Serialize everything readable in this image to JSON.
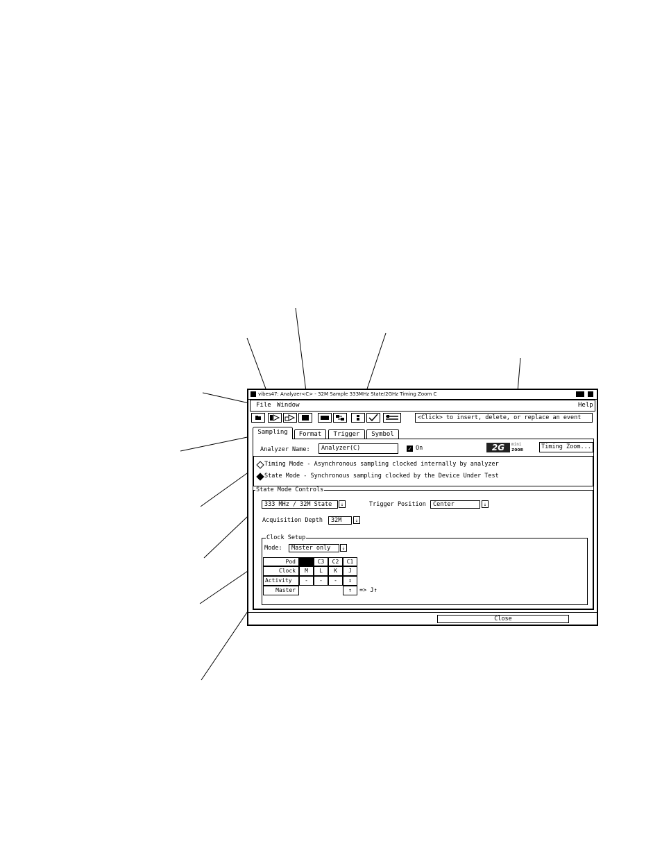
{
  "window": {
    "title": "vibes47: Analyzer<C> - 32M Sample 333MHz State/2GHz Timing Zoom C"
  },
  "menu": {
    "file": "File",
    "window": "Window",
    "help": "Help"
  },
  "toolbar": {
    "hint": "<Click> to insert, delete, or replace an event",
    "icons": [
      "open-folder-icon",
      "run-icon",
      "run-repetitive-icon",
      "stop-icon",
      "display-icon",
      "connect-icon",
      "properties-icon",
      "checkmark-icon",
      "probe-icon"
    ]
  },
  "tabs": {
    "sampling": "Sampling",
    "format": "Format",
    "trigger": "Trigger",
    "symbol": "Symbol"
  },
  "analyzer": {
    "name_label": "Analyzer Name:",
    "name_value": "Analyzer(C)",
    "on_label": "On",
    "on_checked": true,
    "timing_zoom_button": "Timing Zoom..."
  },
  "zoom_logo": {
    "big": "2G",
    "small_top": "mini",
    "small_bottom": "zoom"
  },
  "modes": {
    "timing": "Timing Mode - Asynchronous sampling clocked internally by analyzer",
    "state": "State Mode - Synchronous sampling clocked by the Device Under Test",
    "selected": "state"
  },
  "state_controls": {
    "legend": "State Mode Controls",
    "speed_value": "333 MHz / 32M State",
    "trigger_position_label": "Trigger Position",
    "trigger_position_value": "Center",
    "acq_depth_label": "Acquisition Depth",
    "acq_depth_value": "32M"
  },
  "clock_setup": {
    "legend": "Clock Setup",
    "mode_label": "Mode:",
    "mode_value": "Master only",
    "row_labels": {
      "pod": "Pod",
      "clock": "Clock",
      "activity": "Activity",
      "master": "Master"
    },
    "pods": [
      "",
      "C3",
      "C2",
      "C1"
    ],
    "clocks": [
      "M",
      "L",
      "K",
      "J"
    ],
    "activity": [
      "-",
      "-",
      "-",
      "↕"
    ],
    "master_edge": "↑",
    "result": "=> J↑"
  },
  "footer": {
    "close": "Close"
  }
}
